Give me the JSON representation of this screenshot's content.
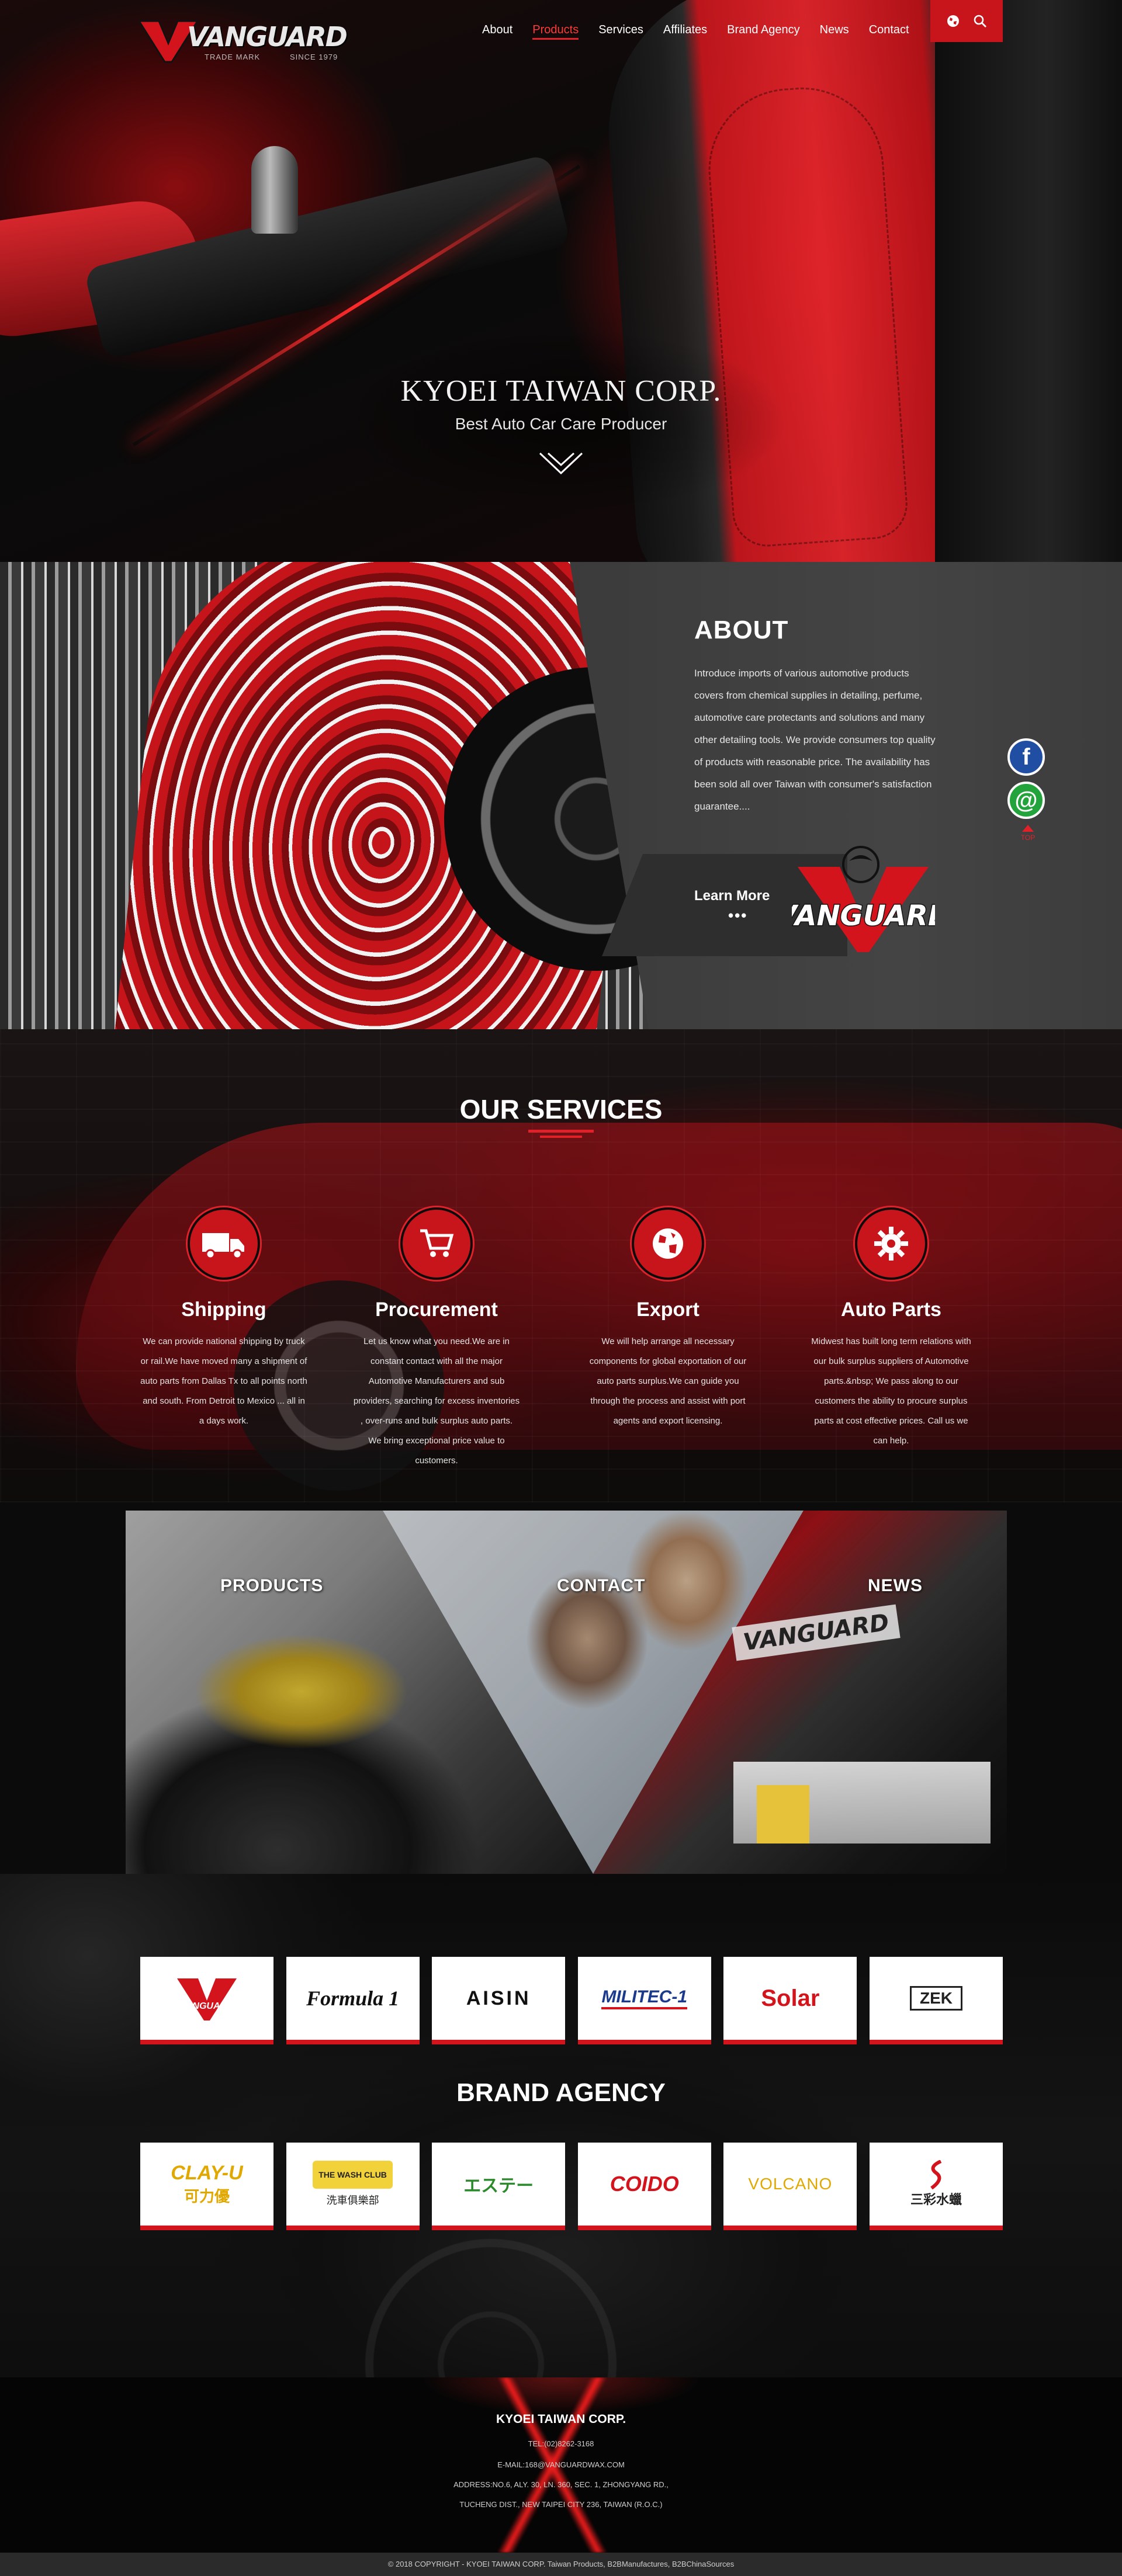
{
  "nav": {
    "logo_word": "VANGUARD",
    "logo_tm": "TRADE MARK",
    "logo_since": "SINCE 1979",
    "items": [
      "About",
      "Products",
      "Services",
      "Affiliates",
      "Brand Agency",
      "News",
      "Contact"
    ],
    "active": "Products",
    "tools": [
      "globe-icon",
      "search-icon"
    ]
  },
  "hero": {
    "title": "KYOEI TAIWAN CORP.",
    "subtitle": "Best Auto Car Care Producer"
  },
  "about": {
    "heading": "ABOUT",
    "body": "Introduce imports of various automotive products covers from chemical supplies in detailing, perfume, automotive care protectants and solutions and many other detailing tools. We provide consumers top quality of products with reasonable price. The availability has been sold all over Taiwan with consumer's satisfaction guarantee....",
    "learn_more": "Learn More",
    "dots": "•••",
    "badge_word": "VANGUARD"
  },
  "social": {
    "fb": "f",
    "mail": "@",
    "top": "TOP"
  },
  "services": {
    "heading": "OUR SERVICES",
    "items": [
      {
        "icon": "truck-icon",
        "title": "Shipping",
        "text": "We can provide national shipping by truck or rail.We have moved many a shipment of auto parts from Dallas Tx to all points north and south. From Detroit to Mexico ... all in a days work."
      },
      {
        "icon": "cart-icon",
        "title": "Procurement",
        "text": "Let us know what you need.We are in constant contact with all the major Automotive Manufacturers and sub providers, searching for excess inventories , over-runs and bulk surplus auto parts. We bring exceptional price value to customers."
      },
      {
        "icon": "globe-icon",
        "title": "Export",
        "text": "We will help arrange all necessary components for global exportation of our auto parts surplus.We can guide you through the process and assist with port agents and export licensing."
      },
      {
        "icon": "gear-icon",
        "title": "Auto Parts",
        "text": "Midwest has built long term relations with our bulk surplus suppliers of Automotive parts.&nbsp; We pass along to our customers the ability to procure surplus parts at cost effective prices. Call us we can help."
      }
    ]
  },
  "panels": {
    "products": "PRODUCTS",
    "contact": "CONTACT",
    "news": "NEWS",
    "booth_logo": "VANGUARD"
  },
  "brands": {
    "heading": "BRAND AGENCY",
    "row1": [
      {
        "name": "VANGUARD",
        "color": "#d3141c"
      },
      {
        "name": "Formula 1",
        "color": "#111111"
      },
      {
        "name": "AISIN",
        "color": "#d3141c"
      },
      {
        "name": "MILITEC-1",
        "color": "#1b3a8c"
      },
      {
        "name": "Solar",
        "color": "#d3141c"
      },
      {
        "name": "ZEK",
        "color": "#222222"
      }
    ],
    "row2": [
      {
        "name": "CLAY-U",
        "color": "#e0a800",
        "sub": "可力優"
      },
      {
        "name": "THE WASH CLUB",
        "color": "#222222",
        "sub": "洗車俱樂部"
      },
      {
        "name": "エステー",
        "color": "#2b8a2b"
      },
      {
        "name": "COIDO",
        "color": "#d3141c"
      },
      {
        "name": "VOLCANO",
        "color": "#e0a800"
      },
      {
        "name": "三彩水蠟",
        "color": "#222222"
      }
    ]
  },
  "footer": {
    "company": "KYOEI TAIWAN CORP.",
    "tel": "TEL:(02)8262-3168",
    "email": "E-MAIL:168@VANGUARDWAX.COM",
    "address1": "ADDRESS:NO.6, ALY. 30, LN. 360, SEC. 1, ZHONGYANG RD.,",
    "address2": "TUCHENG DIST., NEW TAIPEI CITY 236, TAIWAN (R.O.C.)",
    "copyright": "© 2018 COPYRIGHT - KYOEI TAIWAN CORP.  Taiwan Products, B2BManufactures, B2BChinaSources"
  },
  "colors": {
    "accent": "#c8141b",
    "bg": "#0b0b0c"
  }
}
